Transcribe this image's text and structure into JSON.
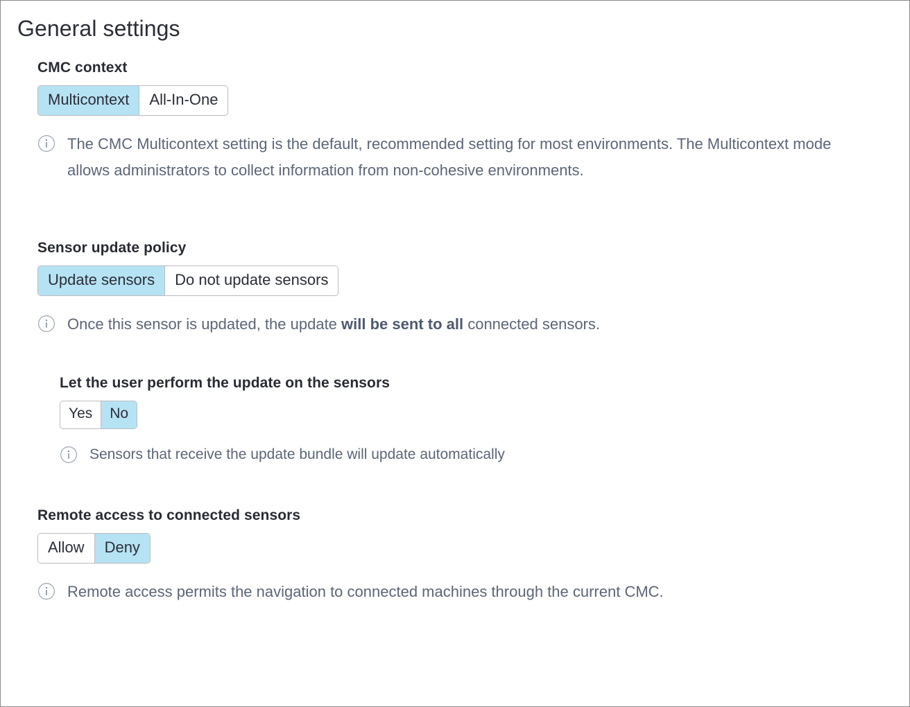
{
  "page": {
    "title": "General settings"
  },
  "sections": [
    {
      "heading": "CMC context",
      "toggle": {
        "options": [
          "Multicontext",
          "All-In-One"
        ],
        "selected": "Multicontext"
      },
      "info": {
        "icon": "info-circle-icon",
        "text_before_bold": "The CMC Multicontext setting is the default, recommended setting for most environments. The Multicontext mode allows administrators to collect information from non-cohesive environments.",
        "bold": "",
        "text_after_bold": ""
      }
    },
    {
      "heading": "Sensor update policy",
      "toggle": {
        "options": [
          "Update sensors",
          "Do not update sensors"
        ],
        "selected": "Update sensors"
      },
      "info": {
        "icon": "info-circle-icon",
        "text_before_bold": "Once this sensor is updated, the update ",
        "bold": "will be sent to all",
        "text_after_bold": " connected sensors."
      },
      "sub_section": {
        "heading": "Let the user perform the update on the sensors",
        "toggle": {
          "options": [
            "Yes",
            "No"
          ],
          "selected": "No"
        },
        "info": {
          "icon": "info-circle-icon",
          "text_before_bold": "Sensors that receive the update bundle will update automatically",
          "bold": "",
          "text_after_bold": ""
        }
      }
    },
    {
      "heading": "Remote access to connected sensors",
      "toggle": {
        "options": [
          "Allow",
          "Deny"
        ],
        "selected": "Deny"
      },
      "info": {
        "icon": "info-circle-icon",
        "text_before_bold": "Remote access permits the navigation to connected machines through the current CMC.",
        "bold": "",
        "text_after_bold": ""
      }
    }
  ],
  "colors": {
    "selected_toggle": "#b6e3f4",
    "toggle_border": "#b9bcc2",
    "info_text": "#5c6677",
    "heading": "#282b33",
    "page_border": "#8a8a8a"
  }
}
